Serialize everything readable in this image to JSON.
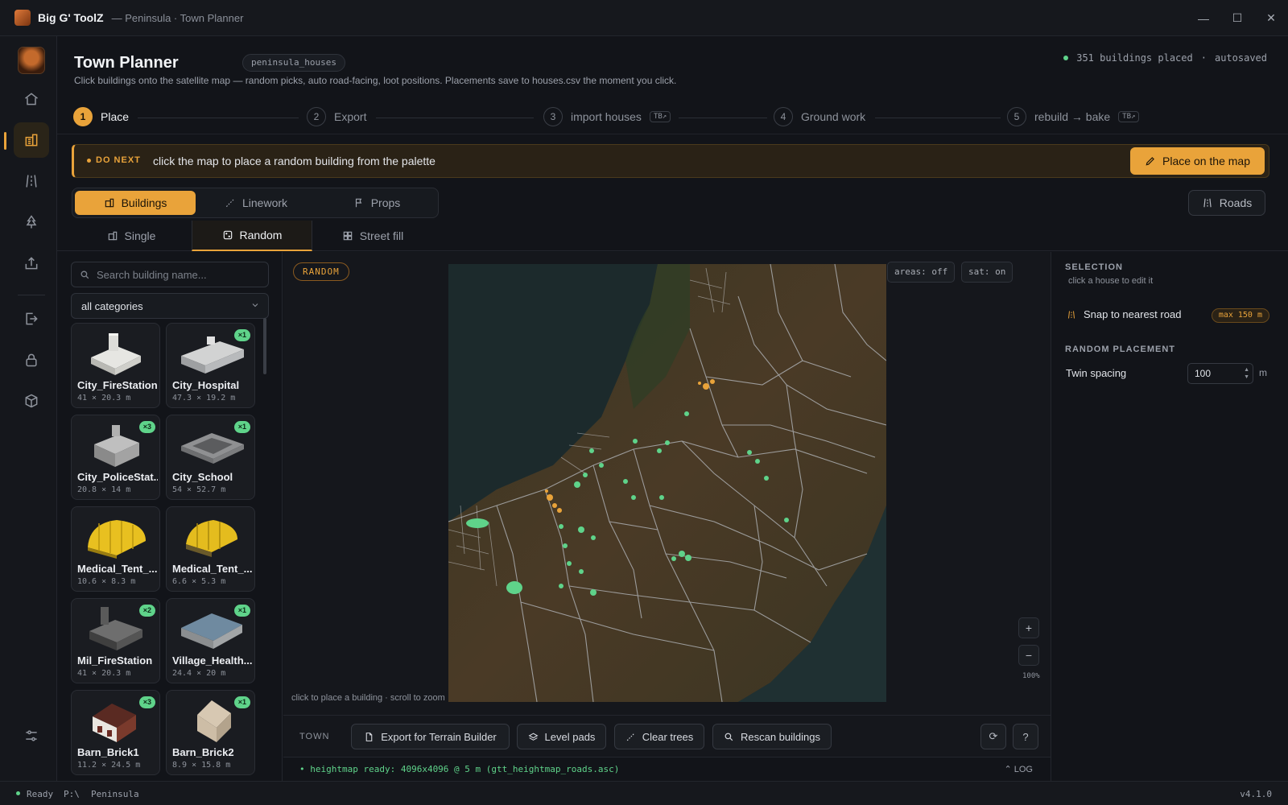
{
  "titlebar": {
    "app_name": "Big G' ToolZ",
    "window_title": "— Peninsula · Town Planner",
    "controls": [
      "—",
      "☐",
      "✕"
    ]
  },
  "rail": {
    "items": [
      "home-icon",
      "buildings-icon",
      "roads-icon",
      "tree-icon",
      "upload-icon",
      "export-icon",
      "lock-icon",
      "cube-icon",
      "sliders-icon"
    ],
    "active": "buildings-icon"
  },
  "header": {
    "title": "Town Planner",
    "project": "peninsula_houses",
    "description": "Click buildings onto the satellite map — random picks, auto road-facing, loot positions. Placements save to houses.csv the moment you click.",
    "placed_count": "351 buildings placed",
    "separator": "·",
    "save_state": "autosaved"
  },
  "stepper": {
    "steps": [
      {
        "num": "1",
        "label": "Place",
        "tag": ""
      },
      {
        "num": "2",
        "label": "Export",
        "tag": ""
      },
      {
        "num": "3",
        "label": "import houses",
        "tag": "TB↗"
      },
      {
        "num": "4",
        "label": "Ground work",
        "tag": ""
      },
      {
        "num": "5",
        "label": "rebuild → bake",
        "tag": "TB↗"
      }
    ]
  },
  "donext": {
    "label": "DO NEXT",
    "text": "click the map to place a random building from the palette",
    "action": "Place on the map"
  },
  "mode_tabs": [
    "Buildings",
    "Linework",
    "Props"
  ],
  "roads_button": "Roads",
  "sub_tabs": [
    "Single",
    "Random",
    "Street fill"
  ],
  "palette": {
    "search_placeholder": "Search building name...",
    "category": "all categories",
    "items": [
      {
        "name": "City_FireStation",
        "dims": "41 × 20.3 m",
        "badge": ""
      },
      {
        "name": "City_Hospital",
        "dims": "47.3 × 19.2 m",
        "badge": "×1"
      },
      {
        "name": "City_PoliceStat...",
        "dims": "20.8 × 14 m",
        "badge": "×3"
      },
      {
        "name": "City_School",
        "dims": "54 × 52.7 m",
        "badge": "×1"
      },
      {
        "name": "Medical_Tent_...",
        "dims": "10.6 × 8.3 m",
        "badge": ""
      },
      {
        "name": "Medical_Tent_...",
        "dims": "6.6 × 5.3 m",
        "badge": ""
      },
      {
        "name": "Mil_FireStation",
        "dims": "41 × 20.3 m",
        "badge": "×2"
      },
      {
        "name": "Village_Health...",
        "dims": "24.4 × 20 m",
        "badge": "×1"
      },
      {
        "name": "Barn_Brick1",
        "dims": "11.2 × 24.5 m",
        "badge": "×3"
      },
      {
        "name": "Barn_Brick2",
        "dims": "8.9 × 15.8 m",
        "badge": "×1"
      }
    ]
  },
  "map": {
    "mode_chip": "RANDOM",
    "areas_chip": "areas: off",
    "sat_chip": "sat: on",
    "zoom_in": "+",
    "zoom_out": "−",
    "zoom_level": "100%",
    "hint": "click to place a building · scroll to zoom"
  },
  "toolbar": {
    "label": "TOWN",
    "buttons": [
      "Export for Terrain Builder",
      "Level pads",
      "Clear trees",
      "Rescan buildings"
    ],
    "refresh": "⟳",
    "help": "?"
  },
  "log": {
    "text": "• heightmap ready: 4096x4096 @ 5 m  (gtt_heightmap_roads.asc)",
    "toggle": "⌃ LOG"
  },
  "right_panel": {
    "selection_title": "SELECTION",
    "selection_hint": "click a house to edit it",
    "snap_label": "Snap to nearest road",
    "snap_max": "max 150 m",
    "random_title": "RANDOM PLACEMENT",
    "twin_label": "Twin spacing",
    "twin_value": "100",
    "twin_unit": "m"
  },
  "statusbar": {
    "state": "Ready",
    "drive": "P:\\",
    "map": "Peninsula",
    "version": "v4.1.0"
  },
  "colors": {
    "accent": "#e9a33a",
    "success": "#5fd38a",
    "background": "#121419"
  }
}
